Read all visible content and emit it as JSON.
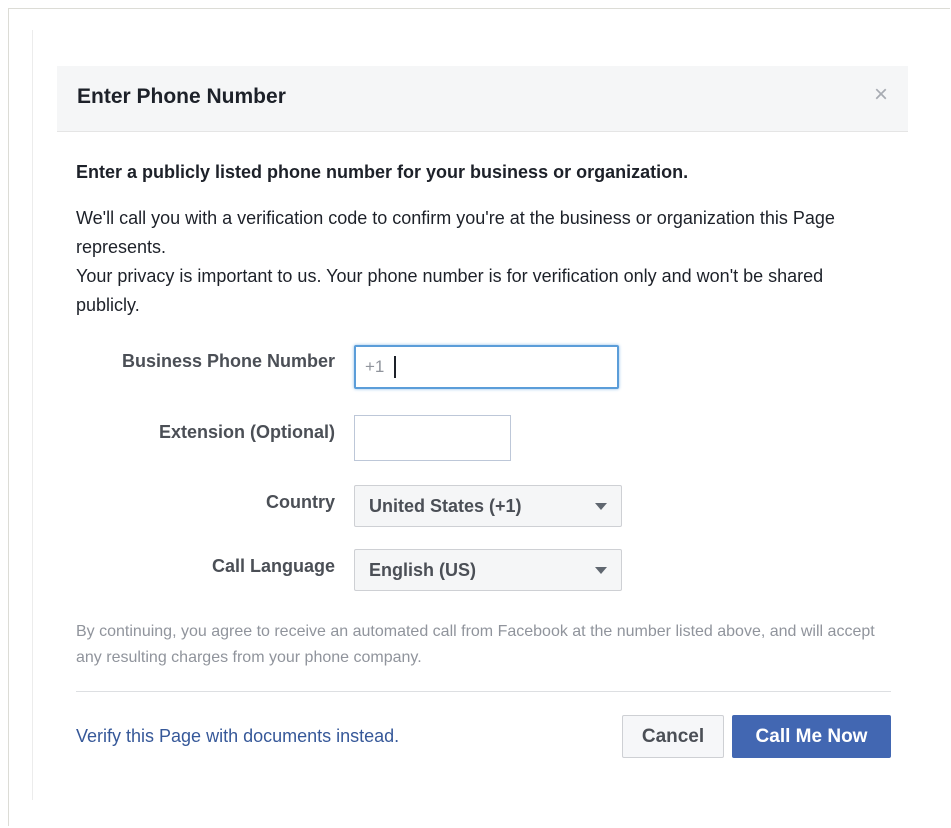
{
  "dialog": {
    "title": "Enter Phone Number",
    "close_icon": "close-icon",
    "lead": "Enter a publicly listed phone number for your business or organization.",
    "desc_line1": "We'll call you with a verification code to confirm you're at the business or organization this Page represents.",
    "desc_line2": "Your privacy is important to us. Your phone number is for verification only and won't be shared publicly."
  },
  "form": {
    "phone_label": "Business Phone Number",
    "phone_prefix": "+1",
    "extension_label": "Extension (Optional)",
    "extension_value": "",
    "country_label": "Country",
    "country_value": "United States (+1)",
    "language_label": "Call Language",
    "language_value": "English (US)"
  },
  "disclaimer": "By continuing, you agree to receive an automated call from Facebook at the number listed above, and will accept any resulting charges from your phone company.",
  "footer": {
    "verify_link": "Verify this Page with documents instead.",
    "cancel_label": "Cancel",
    "call_label": "Call Me Now"
  },
  "colors": {
    "primary_button": "#4267b2",
    "link": "#365899",
    "focus_border": "#5b9dd9"
  }
}
